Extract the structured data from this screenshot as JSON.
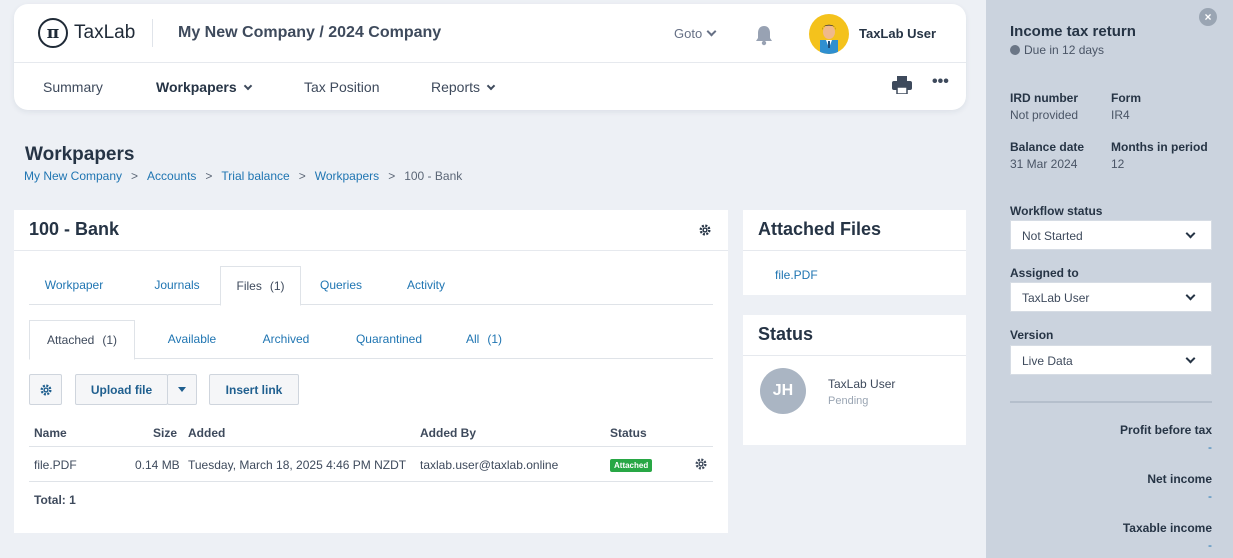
{
  "brand": {
    "logo_glyph": "π",
    "name": "TaxLab"
  },
  "company": "My New Company / 2024 Company",
  "goto_label": "Goto",
  "user": {
    "name": "TaxLab User"
  },
  "nav": {
    "summary": "Summary",
    "workpapers": "Workpapers",
    "tax_position": "Tax Position",
    "reports": "Reports",
    "more": "•••"
  },
  "page": {
    "title": "Workpapers",
    "breadcrumb": [
      "My New Company",
      "Accounts",
      "Trial balance",
      "Workpapers",
      "100 - Bank"
    ],
    "breadcrumb_sep": ">"
  },
  "panel": {
    "title": "100 - Bank",
    "tabs": [
      {
        "label": "Workpaper"
      },
      {
        "label": "Journals"
      },
      {
        "label": "Files",
        "count": "(1)"
      },
      {
        "label": "Queries"
      },
      {
        "label": "Activity"
      }
    ],
    "subtabs": [
      {
        "label": "Attached",
        "count": "(1)"
      },
      {
        "label": "Available"
      },
      {
        "label": "Archived"
      },
      {
        "label": "Quarantined"
      },
      {
        "label": "All",
        "count": "(1)"
      }
    ],
    "toolbar": {
      "upload": "Upload file",
      "insert": "Insert link"
    },
    "columns": [
      "Name",
      "Size",
      "Added",
      "Added By",
      "Status"
    ],
    "rows": [
      {
        "name": "file.PDF",
        "size": "0.14 MB",
        "added": "Tuesday, March 18, 2025 4:46 PM NZDT",
        "added_by": "taxlab.user@taxlab.online",
        "status": "Attached"
      }
    ],
    "total": "Total: 1"
  },
  "attached_files": {
    "title": "Attached Files",
    "file": "file.PDF"
  },
  "status_card": {
    "title": "Status",
    "initials": "JH",
    "user": "TaxLab User",
    "state": "Pending"
  },
  "sidebar": {
    "title": "Income tax return",
    "due": "Due in 12 days",
    "close": "×",
    "ird_label": "IRD number",
    "ird_value": "Not provided",
    "form_label": "Form",
    "form_value": "IR4",
    "balance_label": "Balance date",
    "balance_value": "31 Mar 2024",
    "months_label": "Months in period",
    "months_value": "12",
    "workflow_label": "Workflow status",
    "workflow_value": "Not Started",
    "assigned_label": "Assigned to",
    "assigned_value": "TaxLab User",
    "version_label": "Version",
    "version_value": "Live Data",
    "profit_label": "Profit before tax",
    "profit_value": "-",
    "net_label": "Net income",
    "net_value": "-",
    "taxable_label": "Taxable income",
    "taxable_value": "-"
  },
  "colors": {
    "accent": "#1f75b2",
    "attached_badge": "#28a745",
    "sidebar_bg": "#cbd3de"
  }
}
